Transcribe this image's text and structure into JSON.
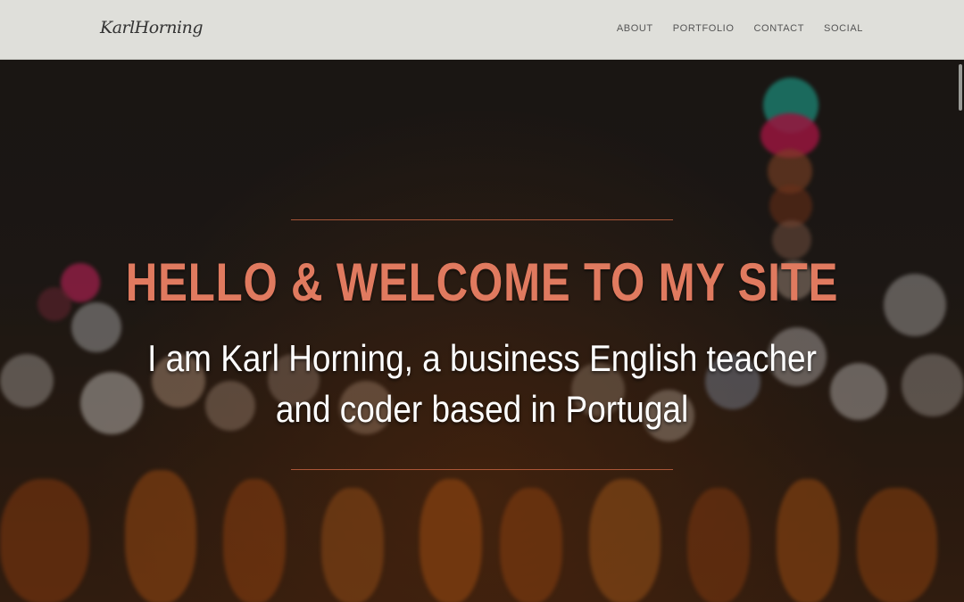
{
  "header": {
    "brand": "KarlHorning",
    "nav": [
      {
        "label": "ABOUT"
      },
      {
        "label": "PORTFOLIO"
      },
      {
        "label": "CONTACT"
      },
      {
        "label": "SOCIAL"
      }
    ]
  },
  "hero": {
    "title": "HELLO & WELCOME TO MY SITE",
    "subtitle": "I am Karl Horning, a business English teacher and coder based in Portugal"
  },
  "colors": {
    "title": "#e07a5f",
    "subtitle": "#ffffff",
    "rule": "#c0603f",
    "navbar_bg": "#dfdfda"
  }
}
